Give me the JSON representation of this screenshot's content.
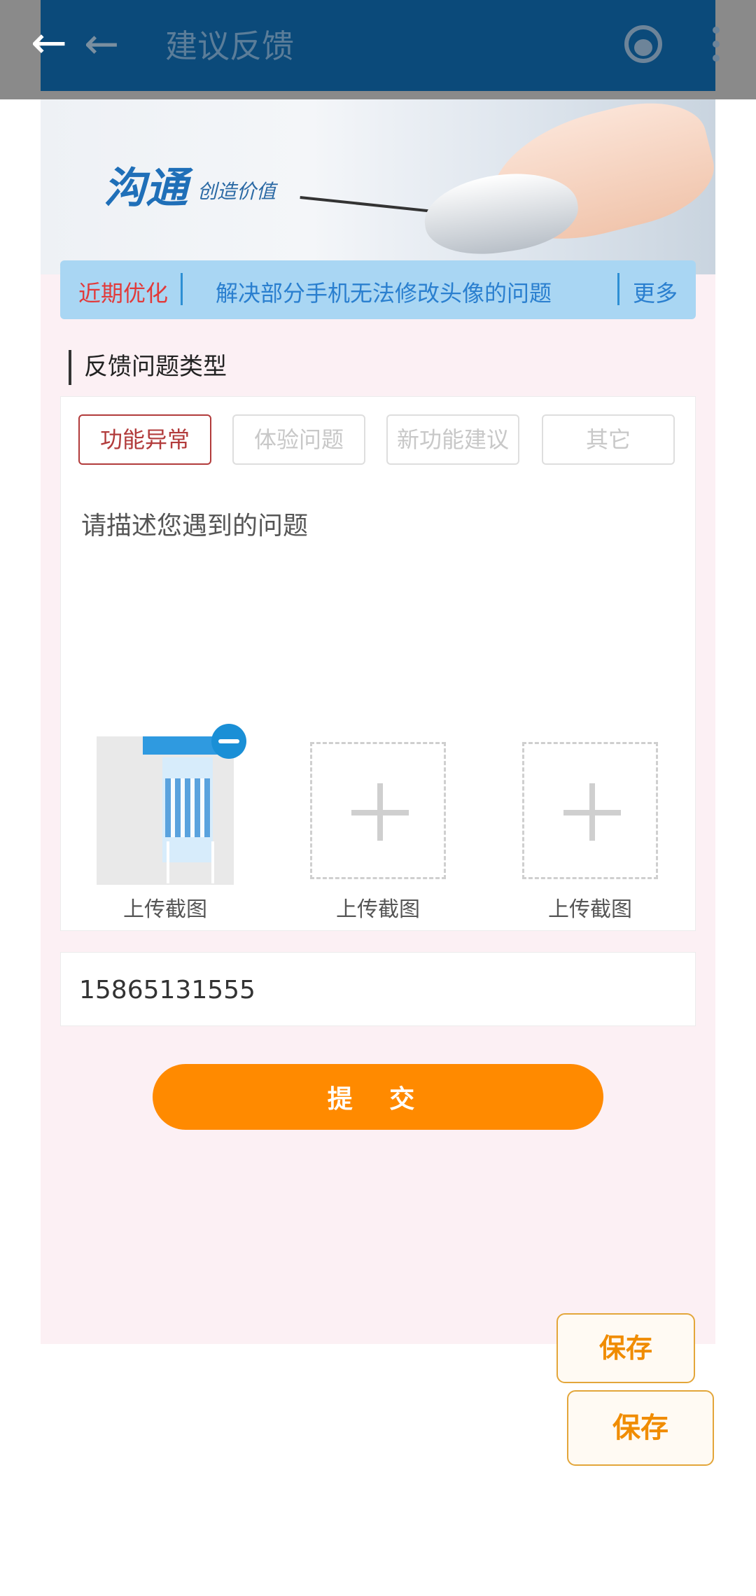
{
  "appbar": {
    "title": "建议反馈",
    "back_icon": "arrow-left-icon",
    "support_icon": "headset-icon",
    "menu_icon": "more-vertical-icon",
    "background": "#0b4a7a"
  },
  "banner": {
    "headline": "沟通",
    "tagline": "创造价值"
  },
  "notice": {
    "tag": "近期优化",
    "message": "解决部分手机无法修改头像的问题",
    "more": "更多"
  },
  "feedback": {
    "section_title": "反馈问题类型",
    "types": [
      {
        "label": "功能异常",
        "selected": true
      },
      {
        "label": "体验问题",
        "selected": false
      },
      {
        "label": "新功能建议",
        "selected": false
      },
      {
        "label": "其它",
        "selected": false
      }
    ],
    "description_placeholder": "请描述您遇到的问题",
    "uploads": [
      {
        "label": "上传截图",
        "has_image": true
      },
      {
        "label": "上传截图",
        "has_image": false
      },
      {
        "label": "上传截图",
        "has_image": false
      }
    ]
  },
  "contact": {
    "phone": "15865131555"
  },
  "submit_label": "提 交",
  "save_buttons": [
    "保存",
    "保存"
  ],
  "colors": {
    "accent": "#ff8a00",
    "selected": "#b23b3b",
    "notice_bg": "#a9d6f3"
  }
}
